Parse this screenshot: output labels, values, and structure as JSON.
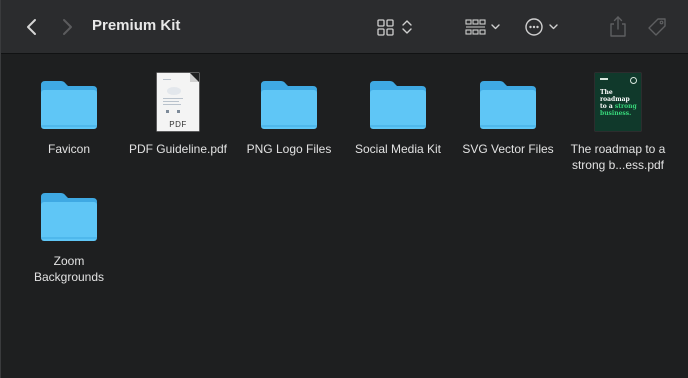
{
  "window": {
    "title": "Premium Kit",
    "accent_folder": "#5fc6f6",
    "accent_folder_tab": "#3fa9e3"
  },
  "toolbar": {
    "back_icon": "chevron-left-icon",
    "forward_icon": "chevron-right-icon",
    "view_icon": "icon-grid-view-icon",
    "group_icon": "group-by-icon",
    "more_icon": "ellipsis-circle-icon",
    "share_icon": "share-icon",
    "tags_icon": "tag-icon"
  },
  "files": [
    {
      "name": "Favicon",
      "kind": "folder"
    },
    {
      "name": "PDF Guideline.pdf",
      "kind": "pdf",
      "badge": "PDF"
    },
    {
      "name": "PNG Logo Files",
      "kind": "folder"
    },
    {
      "name": "Social Media Kit",
      "kind": "folder"
    },
    {
      "name": "SVG Vector Files",
      "kind": "folder"
    },
    {
      "name": "The roadmap to a strong b...ess.pdf",
      "kind": "book",
      "cover_line1": "The",
      "cover_line2": "roadmap",
      "cover_line3": "to a",
      "cover_line4": "strong",
      "cover_line5": "business."
    },
    {
      "name": "Zoom Backgrounds",
      "kind": "folder"
    }
  ]
}
